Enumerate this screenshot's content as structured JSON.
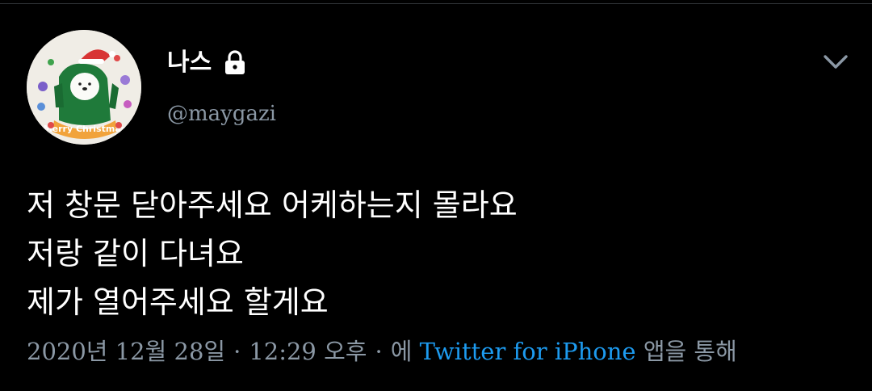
{
  "tweet": {
    "author": {
      "display_name": "나스",
      "handle": "@maygazi",
      "avatar_label": "Merry Christmas",
      "protected_icon": "lock-icon"
    },
    "menu_icon": "chevron-down-icon",
    "lines": [
      "저 창문 닫아주세요 어케하는지 몰라요",
      "저랑 같이 다녀요",
      "제가 열어주세요 할게요"
    ],
    "meta": {
      "date": "2020년 12월 28일",
      "separator": "·",
      "time": "12:29 오후",
      "via_prefix": "에",
      "source": "Twitter for iPhone",
      "via_suffix": "앱을 통해"
    }
  },
  "colors": {
    "background": "#000000",
    "text": "#ffffff",
    "secondary": "#8b98a5",
    "link": "#1d9bf0"
  }
}
